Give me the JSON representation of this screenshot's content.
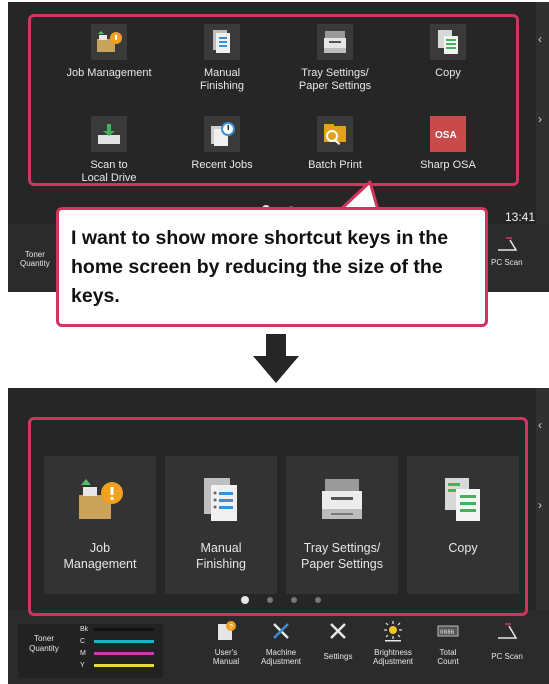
{
  "top_screen": {
    "keys": [
      {
        "label": "Job Management",
        "icon": "job-management-icon"
      },
      {
        "label": "Manual\nFinishing",
        "icon": "manual-finishing-icon"
      },
      {
        "label": "Tray Settings/\nPaper Settings",
        "icon": "tray-settings-icon"
      },
      {
        "label": "Copy",
        "icon": "copy-icon"
      },
      {
        "label": "Scan to\nLocal Drive",
        "icon": "scan-to-local-drive-icon"
      },
      {
        "label": "Recent Jobs",
        "icon": "recent-jobs-icon"
      },
      {
        "label": "Batch Print",
        "icon": "batch-print-icon"
      },
      {
        "label": "Sharp OSA",
        "icon": "sharp-osa-icon"
      }
    ],
    "clock": "13:41",
    "taskbar_partial": {
      "toner_label": "Toner\nQuantity",
      "pc_scan": "PC Scan"
    }
  },
  "callout": {
    "text": "I want to show more shortcut keys in the home screen by reducing the size of the keys.",
    "border_color": "#d1355e"
  },
  "arrow": {
    "icon": "down-arrow-icon"
  },
  "bottom_screen": {
    "keys": [
      {
        "label": "Job\nManagement",
        "icon": "job-management-icon"
      },
      {
        "label": "Manual\nFinishing",
        "icon": "manual-finishing-icon"
      },
      {
        "label": "Tray Settings/\nPaper Settings",
        "icon": "tray-settings-icon"
      },
      {
        "label": "Copy",
        "icon": "copy-icon"
      }
    ],
    "page_dots": 4,
    "active_dot": 0,
    "taskbar": {
      "toner_label": "Toner\nQuantity",
      "toner_colors": [
        {
          "label": "Bk",
          "color": "#111111"
        },
        {
          "label": "C",
          "color": "#19b3c9"
        },
        {
          "label": "M",
          "color": "#c43bb3"
        },
        {
          "label": "Y",
          "color": "#e8d83a"
        }
      ],
      "items": [
        {
          "label": "User's\nManual",
          "icon": "users-manual-icon"
        },
        {
          "label": "Machine\nAdjustment",
          "icon": "machine-adjustment-icon"
        },
        {
          "label": "Settings",
          "icon": "settings-icon"
        },
        {
          "label": "Brightness\nAdjustment",
          "icon": "brightness-adjustment-icon"
        },
        {
          "label": "Total\nCount",
          "icon": "total-count-icon"
        },
        {
          "label": "PC Scan",
          "icon": "pc-scan-icon"
        }
      ]
    }
  },
  "colors": {
    "highlight": "#d1355e",
    "screen_bg": "#262626"
  }
}
